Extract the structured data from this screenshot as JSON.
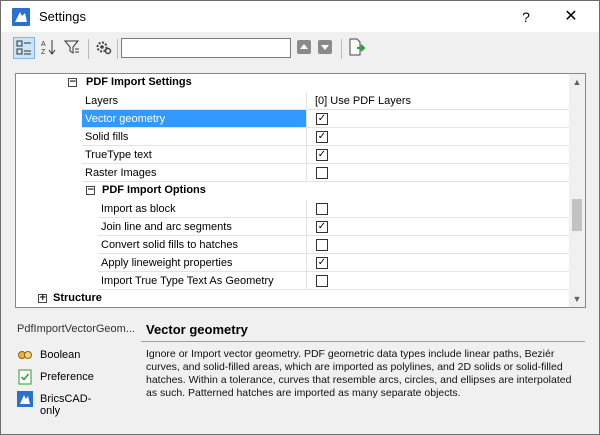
{
  "window": {
    "title": "Settings",
    "help_label": "?",
    "close_label": "✕"
  },
  "toolbar": {
    "search_value": "",
    "buttons": [
      "categorized-view",
      "alphabetical-view",
      "filter",
      "settings",
      "move-up",
      "move-down",
      "export"
    ]
  },
  "tree": {
    "pdf_import_settings": {
      "label": "PDF Import Settings",
      "expanded": true,
      "rows": [
        {
          "name": "Layers",
          "value": "[0] Use PDF Layers"
        },
        {
          "name": "Vector geometry",
          "checked": true,
          "selected": true
        },
        {
          "name": "Solid fills",
          "checked": true
        },
        {
          "name": "TrueType text",
          "checked": true
        },
        {
          "name": "Raster Images",
          "checked": false
        }
      ]
    },
    "pdf_import_options": {
      "label": "PDF Import Options",
      "expanded": true,
      "rows": [
        {
          "name": "Import as block",
          "checked": false
        },
        {
          "name": "Join line and arc segments",
          "checked": true
        },
        {
          "name": "Convert solid fills to hatches",
          "checked": false
        },
        {
          "name": "Apply lineweight properties",
          "checked": true
        },
        {
          "name": "Import True Type Text As Geometry",
          "checked": false
        }
      ]
    },
    "structure": {
      "label": "Structure",
      "expanded": false
    }
  },
  "description": {
    "variable_name": "PdfImportVectorGeom...",
    "title": "Vector geometry",
    "text": "Ignore or Import vector geometry. PDF geometric data types include linear paths, Beziér curves, and solid-filled areas, which are imported as polylines, and 2D solids or solid-filled hatches. Within a tolerance, curves that resemble arcs, circles, and ellipses are interpolated as such. Patterned hatches are imported as many separate objects.",
    "legend": [
      {
        "label": "Boolean",
        "icon": "boolean-icon"
      },
      {
        "label": "Preference",
        "icon": "preference-icon"
      },
      {
        "label": "BricsCAD-only",
        "icon": "bricscad-icon"
      }
    ]
  },
  "colors": {
    "selection": "#3399ff",
    "accent": "#2b6fd0"
  }
}
